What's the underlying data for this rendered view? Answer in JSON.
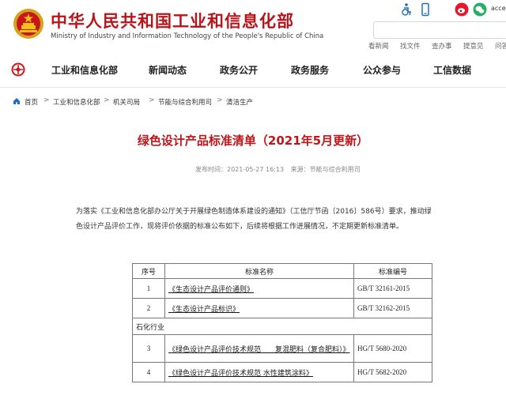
{
  "header": {
    "site_title": "中华人民共和国工业和信息化部",
    "site_subtitle": "Ministry of Industry and Information Technology of the People's Republic of China",
    "lang_link": "access",
    "quick_links": [
      "看新闻",
      "找文件",
      "查办事",
      "提意见",
      "问答室"
    ],
    "top_icons": [
      "accessibility-icon",
      "mobile-icon",
      "weibo-icon",
      "wechat-icon"
    ],
    "brand_color": "#b8141a"
  },
  "nav": {
    "items": [
      "工业和信息化部",
      "新闻动态",
      "政务公开",
      "政务服务",
      "公众参与",
      "工信数据"
    ]
  },
  "breadcrumb": {
    "items": [
      "首页",
      "工业和信息化部",
      "机关司局",
      "节能与综合利用司",
      "清洁生产"
    ]
  },
  "article": {
    "title": "绿色设计产品标准清单（2021年5月更新）",
    "published": "发布时间：2021-05-27 16:13",
    "source": "来源：节能与综合利用司",
    "intro": "为落实《工业和信息化部办公厅关于开展绿色制造体系建设的通知》（工信厅节函〔2016〕586号）要求，推动绿色设计产品评价工作，现将评价依据的标准公布如下，后续将根据工作进展情况，不定期更新标准清单。"
  },
  "table": {
    "headers": [
      "序号",
      "标准名称",
      "标准编号"
    ],
    "rows_a": [
      {
        "no": "1",
        "name": "《生态设计产品评价通则》",
        "code": "GB/T 32161-2015"
      },
      {
        "no": "2",
        "name": "《生态设计产品标识》",
        "code": "GB/T 32162-2015"
      }
    ],
    "section": "石化行业",
    "rows_b": [
      {
        "no": "3",
        "name": "《绿色设计产品评价技术规范　　复混肥料（复合肥料）》",
        "code": "HG/T 5680-2020"
      },
      {
        "no": "4",
        "name": "《绿色设计产品评价技术规范 水性建筑涂料》",
        "code": "HG/T 5682-2020"
      }
    ]
  }
}
